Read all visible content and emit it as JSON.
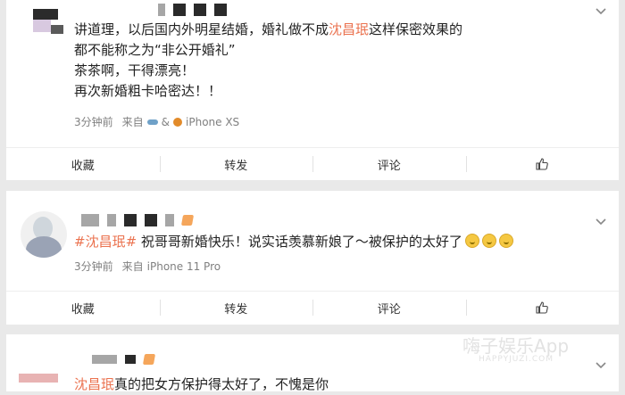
{
  "colors": {
    "topic": "#eb7350",
    "background": "#e9e9e9",
    "card": "#ffffff"
  },
  "posts": [
    {
      "lines": [
        {
          "before": "讲道理，以后国内外明星结婚，婚礼做不成",
          "topic": "沈昌珉",
          "after": "这样保密效果的"
        },
        {
          "text": "都不能称之为“非公开婚礼”"
        },
        {
          "text": "茶茶啊，干得漂亮！"
        },
        {
          "text": "再次新婚粗卡哈密达！！"
        }
      ],
      "time": "3分钟前",
      "source_prefix": "来自",
      "device": "iPhone XS"
    },
    {
      "topic": "#沈昌珉#",
      "text": " 祝哥哥新婚快乐！说实话羡慕新娘了～被保护的太好了",
      "emoji_count": 3,
      "time": "3分钟前",
      "source_prefix": "来自",
      "device": "iPhone 11 Pro"
    },
    {
      "topic": "沈昌珉",
      "text": "真的把女方保护得太好了，不愧是你"
    }
  ],
  "actions": {
    "collect": "收藏",
    "repost": "转发",
    "comment": "评论"
  },
  "watermark": {
    "title": "嗨子娱乐App",
    "subtitle": "HAPPYJUZI.COM"
  }
}
